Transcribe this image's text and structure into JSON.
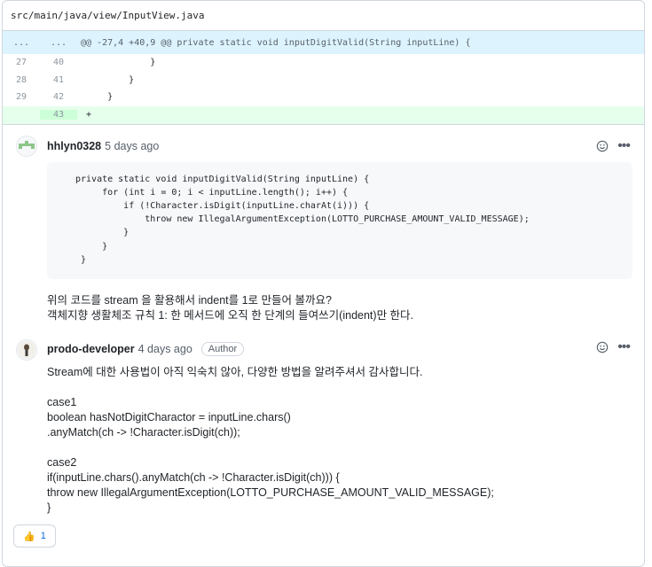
{
  "file": {
    "path": "src/main/java/view/InputView.java"
  },
  "diff": {
    "hunk": {
      "old": "...",
      "new": "...",
      "text": "@@ -27,4 +40,9 @@ private static void inputDigitValid(String inputLine) {"
    },
    "lines": [
      {
        "old": "27",
        "new": "40",
        "code": "            }"
      },
      {
        "old": "28",
        "new": "41",
        "code": "        }"
      },
      {
        "old": "29",
        "new": "42",
        "code": "    }"
      },
      {
        "old": "",
        "new": "43",
        "code": "+"
      }
    ]
  },
  "comment1": {
    "author": "hhlyn0328",
    "time": "5 days ago",
    "code": "private static void inputDigitValid(String inputLine) {\n     for (int i = 0; i < inputLine.length(); i++) {\n         if (!Character.isDigit(inputLine.charAt(i))) {\n             throw new IllegalArgumentException(LOTTO_PURCHASE_AMOUNT_VALID_MESSAGE);\n         }\n     }\n }",
    "text1": "위의 코드를 stream 을 활용해서 indent를 1로 만들어 볼까요?",
    "text2": "객체지향 생활체조 규칙 1: 한 메서드에 오직 한 단계의 들여쓰기(indent)만 한다."
  },
  "comment2": {
    "author": "prodo-developer",
    "time": "4 days ago",
    "badge": "Author",
    "lines": [
      "Stream에 대한 사용법이 아직 익숙치 않아, 다양한 방법을 알려주셔서 감사합니다.",
      "",
      "case1",
      "boolean hasNotDigitCharactor = inputLine.chars()",
      ".anyMatch(ch -> !Character.isDigit(ch));",
      "",
      "case2",
      "if(inputLine.chars().anyMatch(ch -> !Character.isDigit(ch))) {",
      "throw new IllegalArgumentException(LOTTO_PURCHASE_AMOUNT_VALID_MESSAGE);",
      "}"
    ]
  },
  "reaction": {
    "emoji": "👍",
    "count": "1"
  },
  "icons": {
    "smile": "smiley-icon",
    "menu": "kebab-horizontal-icon"
  },
  "colors": {
    "hunk_bg": "#ddf4ff",
    "add_bg": "#e6ffec",
    "add_ln": "#ccffd8",
    "link": "#0969da"
  }
}
